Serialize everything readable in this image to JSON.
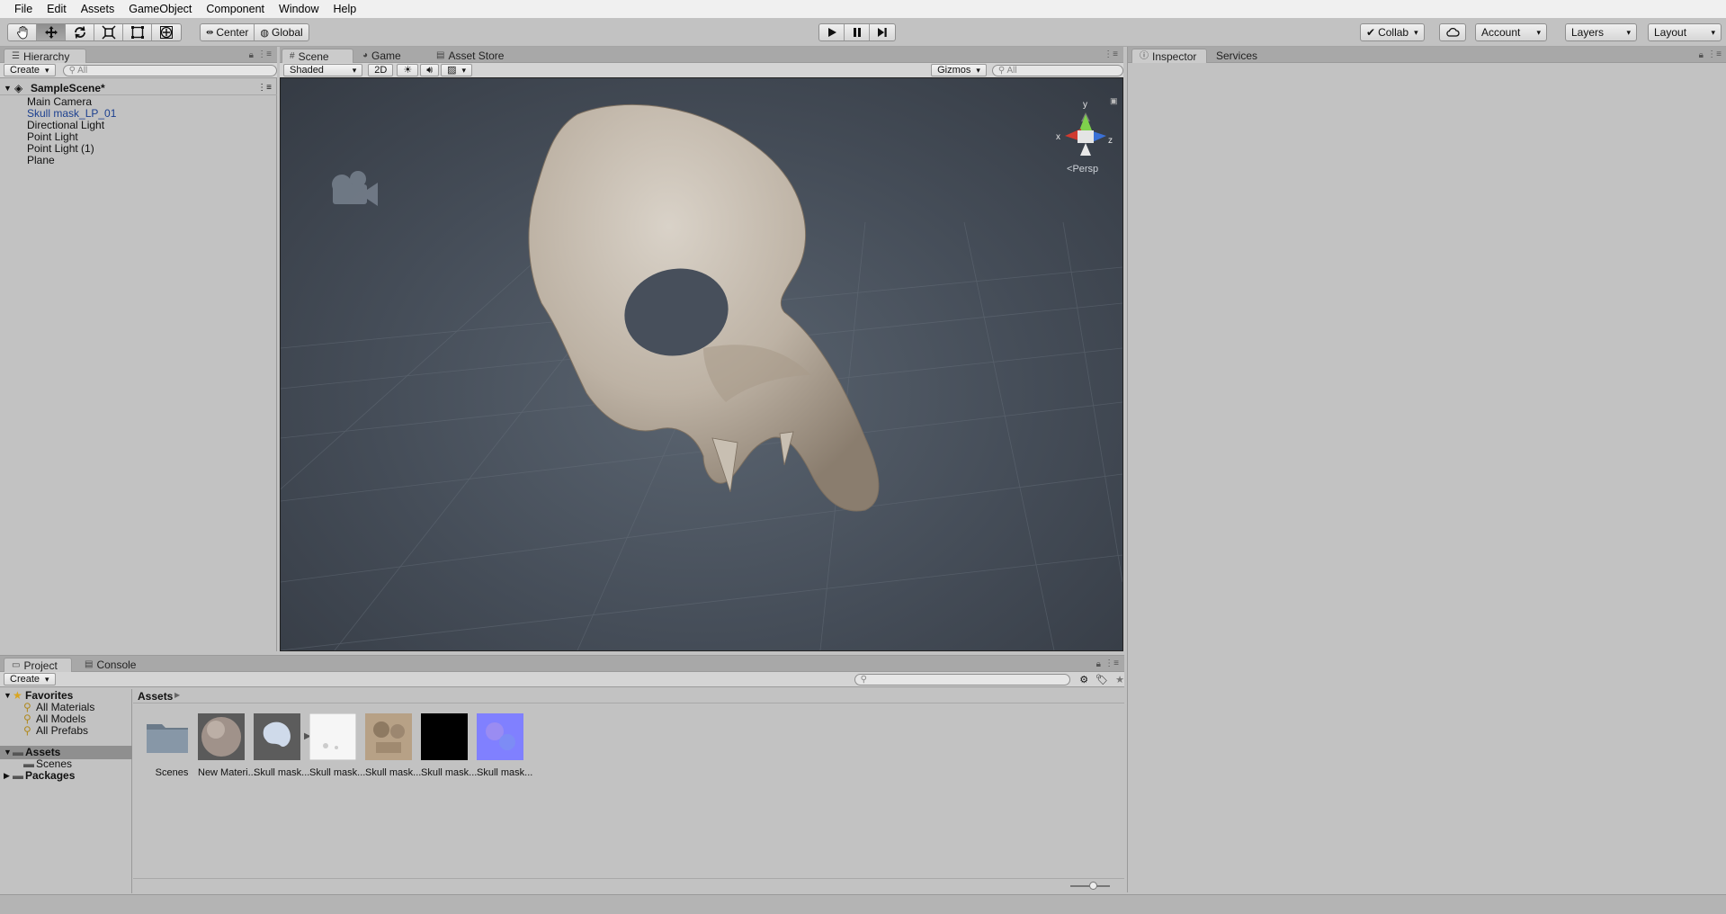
{
  "menu": [
    "File",
    "Edit",
    "Assets",
    "GameObject",
    "Component",
    "Window",
    "Help"
  ],
  "toolbar": {
    "pivot": "Center",
    "space": "Global",
    "collab": "Collab",
    "account": "Account",
    "layers": "Layers",
    "layout": "Layout"
  },
  "hierarchy": {
    "tab": "Hierarchy",
    "create": "Create",
    "search_placeholder": "All",
    "scene": "SampleScene*",
    "items": [
      "Main Camera",
      "Skull mask_LP_01",
      "Directional Light",
      "Point Light",
      "Point Light (1)",
      "Plane"
    ]
  },
  "scene": {
    "tabs": [
      "Scene",
      "Game",
      "Asset Store"
    ],
    "shading": "Shaded",
    "mode_2d": "2D",
    "gizmos": "Gizmos",
    "search_placeholder": "All",
    "persp": "Persp",
    "axis_x": "x",
    "axis_y": "y",
    "axis_z": "z"
  },
  "inspector": {
    "tabs": [
      "Inspector",
      "Services"
    ]
  },
  "project": {
    "tabs": [
      "Project",
      "Console"
    ],
    "create": "Create",
    "favorites": "Favorites",
    "favorite_items": [
      "All Materials",
      "All Models",
      "All Prefabs"
    ],
    "assets_root": "Assets",
    "scenes": "Scenes",
    "packages": "Packages",
    "breadcrumb": "Assets",
    "assets": [
      "Scenes",
      "New Materi...",
      "Skull mask...",
      "Skull mask...",
      "Skull mask...",
      "Skull mask...",
      "Skull mask..."
    ]
  },
  "colors": {
    "selected_text": "#1b3f8f",
    "viewport_bg": "#454d58",
    "normal_map": "#8080ff"
  }
}
